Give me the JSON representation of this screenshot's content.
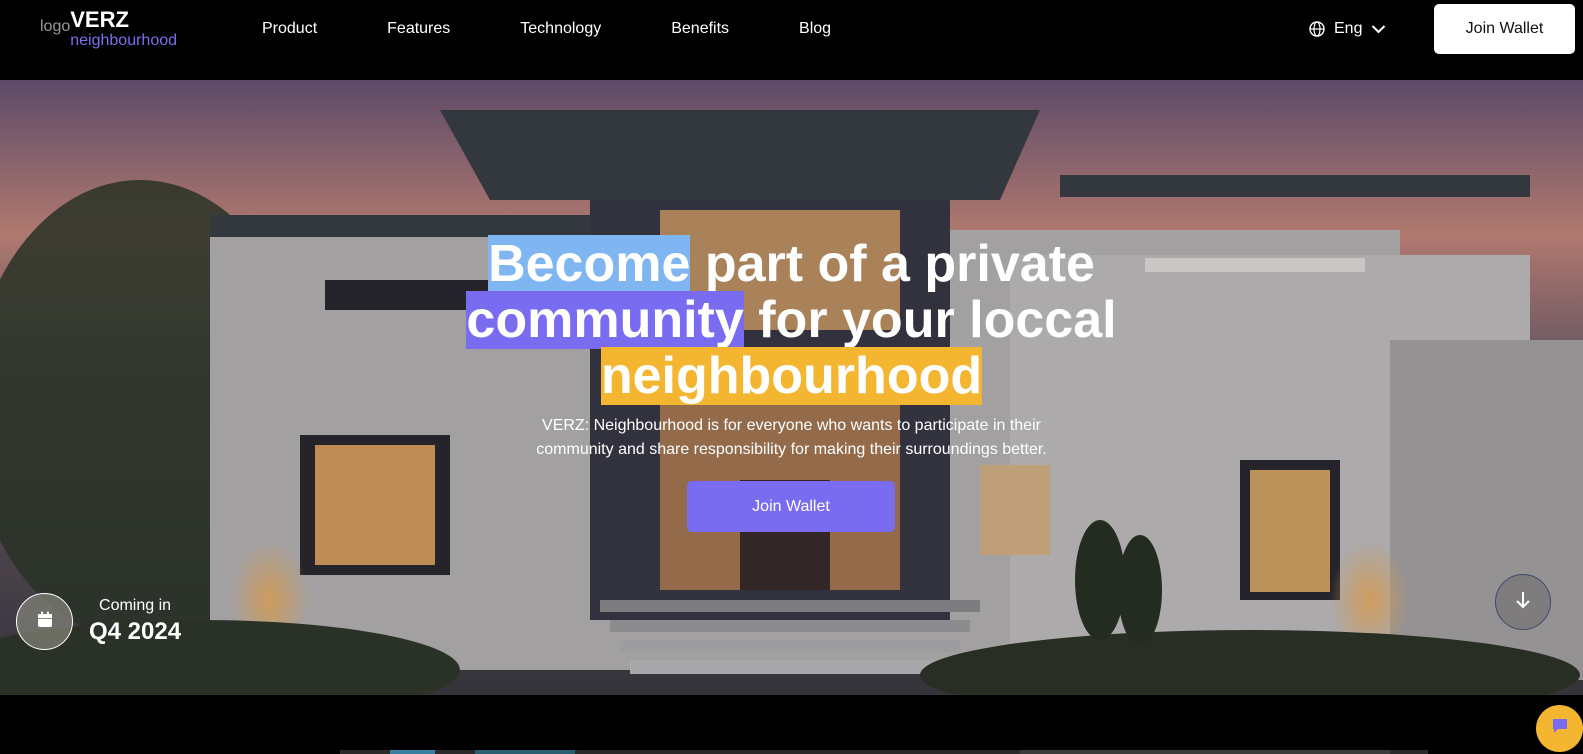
{
  "brand": {
    "logo_alt": "logo",
    "title": "VERZ",
    "subtitle": "neighbourhood"
  },
  "nav": {
    "items": [
      {
        "label": "Product"
      },
      {
        "label": "Features"
      },
      {
        "label": "Technology"
      },
      {
        "label": "Benefits"
      },
      {
        "label": "Blog"
      }
    ],
    "language": "Eng",
    "join_label": "Join Wallet"
  },
  "hero": {
    "headline": {
      "part1": "Become",
      "part2": " part of a private",
      "part3": "community",
      "part4": " for your loccal",
      "part5": "neighbourhood"
    },
    "subtitle_line1": "VERZ: Neighbourhood is for everyone who wants to participate in their",
    "subtitle_line2": "community and share responsibility for making their surroundings better.",
    "cta_label": "Join Wallet",
    "coming_label": "Coming in",
    "coming_value": "Q4 2024"
  },
  "colors": {
    "accent_purple": "#7a6cf0",
    "highlight_blue": "#7fb6f2",
    "highlight_yellow": "#f4b630"
  },
  "icons": {
    "language": "globe-icon",
    "dropdown": "chevron-down-icon",
    "calendar": "calendar-icon",
    "scroll": "arrow-down-icon",
    "chat": "chat-icon"
  }
}
